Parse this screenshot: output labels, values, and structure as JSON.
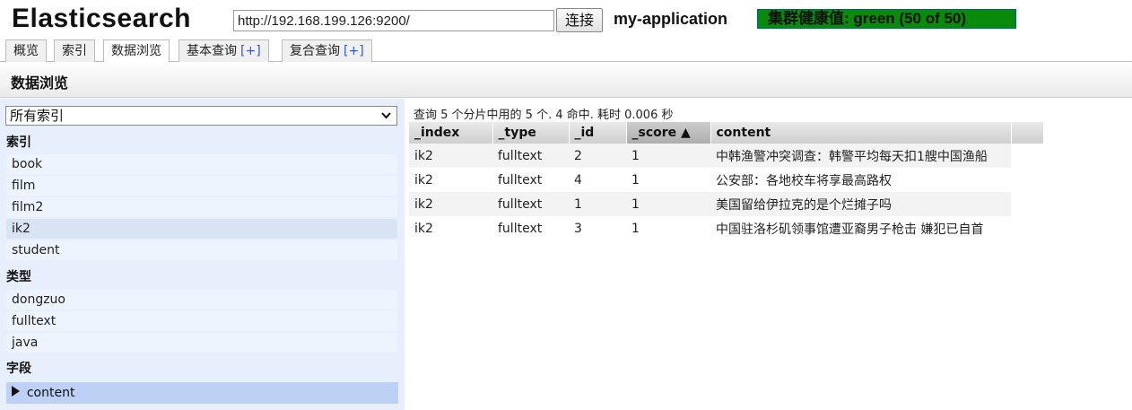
{
  "header": {
    "app_title": "Elasticsearch",
    "url_value": "http://192.168.199.126:9200/",
    "connect_label": "连接",
    "cluster_name": "my-application",
    "health_text": "集群健康值: green (50 of 50)",
    "health_color": "#0a8a0a"
  },
  "tabs": [
    {
      "label": "概览"
    },
    {
      "label": "索引"
    },
    {
      "label": "数据浏览"
    },
    {
      "label": "基本查询",
      "plus": "[+]"
    },
    {
      "label": "复合查询",
      "plus": "[+]"
    }
  ],
  "page_title": "数据浏览",
  "sidebar": {
    "index_select": "所有索引",
    "indices_heading": "索引",
    "indices": [
      "book",
      "film",
      "film2",
      "ik2",
      "student"
    ],
    "selected_index": "ik2",
    "types_heading": "类型",
    "types": [
      "dongzuo",
      "fulltext",
      "java"
    ],
    "fields_heading": "字段",
    "fields": [
      "content"
    ]
  },
  "results": {
    "summary": "查询 5 个分片中用的 5 个. 4 命中. 耗时 0.006 秒",
    "columns": [
      "_index",
      "_type",
      "_id",
      "_score ▲",
      "content"
    ],
    "rows": [
      [
        "ik2",
        "fulltext",
        "2",
        "1",
        "中韩渔警冲突调查：韩警平均每天扣1艘中国渔船"
      ],
      [
        "ik2",
        "fulltext",
        "4",
        "1",
        "公安部：各地校车将享最高路权"
      ],
      [
        "ik2",
        "fulltext",
        "1",
        "1",
        "美国留给伊拉克的是个烂摊子吗"
      ],
      [
        "ik2",
        "fulltext",
        "3",
        "1",
        "中国驻洛杉矶领事馆遭亚裔男子枪击 嫌犯已自首"
      ]
    ]
  }
}
